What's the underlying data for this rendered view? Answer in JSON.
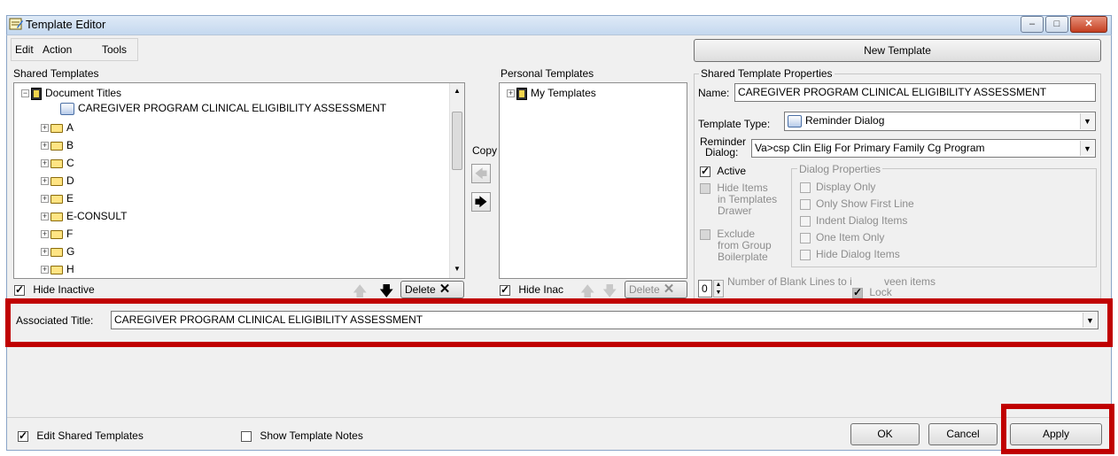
{
  "window": {
    "title": "Template Editor",
    "min": "–",
    "max": "□",
    "close": "✕"
  },
  "menu": {
    "edit": "Edit",
    "action": "Action",
    "tools": "Tools"
  },
  "new_template_button": "New Template",
  "shared": {
    "header": "Shared Templates",
    "root": "Document Titles",
    "selected": "CAREGIVER PROGRAM CLINICAL ELIGIBILITY ASSESSMENT",
    "folders": [
      "A",
      "B",
      "C",
      "D",
      "E",
      "E-CONSULT",
      "F",
      "G",
      "H"
    ],
    "hide_inactive": "Hide Inactive",
    "delete": "Delete"
  },
  "copy_label": "Copy",
  "personal": {
    "header": "Personal Templates",
    "root": "My Templates",
    "hide_inactive": "Hide Inac",
    "delete": "Delete"
  },
  "properties": {
    "header": "Shared Template Properties",
    "name_label": "Name:",
    "name_value": "CAREGIVER PROGRAM CLINICAL ELIGIBILITY ASSESSMENT",
    "type_label": "Template Type:",
    "type_value": "Reminder Dialog",
    "reminder_label_1": "Reminder",
    "reminder_label_2": "Dialog:",
    "reminder_value": "Va>csp Clin Elig For Primary Family Cg Program",
    "active": "Active",
    "hide_items_1": "Hide Items",
    "hide_items_2": "in Templates",
    "hide_items_3": "Drawer",
    "exclude_1": "Exclude",
    "exclude_2": "from Group",
    "exclude_3": "Boilerplate",
    "dialog_props_header": "Dialog Properties",
    "dialog_props": [
      "Display Only",
      "Only Show First Line",
      "Indent Dialog Items",
      "One Item Only",
      "Hide Dialog Items"
    ],
    "blank_lines_value": "0",
    "blank_lines_label": "Number of Blank Lines to i",
    "blank_lines_tail": "veen items",
    "lock": "Lock"
  },
  "associated": {
    "label": "Associated Title:",
    "value": "CAREGIVER PROGRAM CLINICAL ELIGIBILITY ASSESSMENT"
  },
  "footer": {
    "edit_shared": "Edit Shared Templates",
    "show_notes": "Show Template Notes",
    "ok": "OK",
    "cancel": "Cancel",
    "apply": "Apply"
  },
  "colors": {
    "highlight_border": "#c00000",
    "window_bg": "#f0f0f0"
  }
}
